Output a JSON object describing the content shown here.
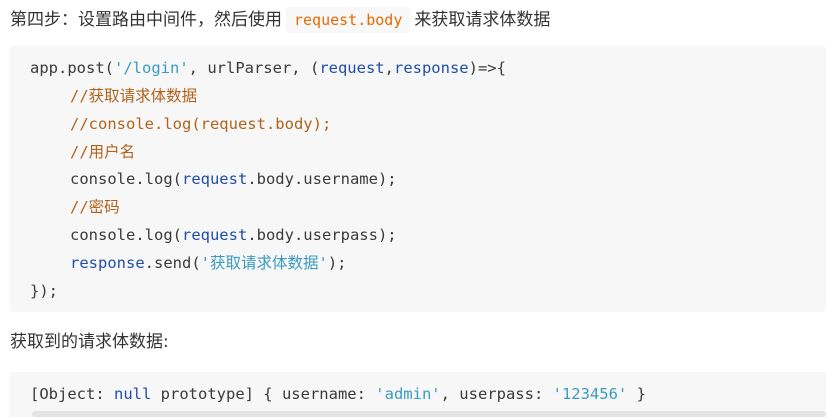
{
  "step": {
    "prefix": "第四步：设置路由中间件，然后使用",
    "inline_code": "request.body",
    "suffix": "来获取请求体数据"
  },
  "code": {
    "l1": {
      "p1": "app.post(",
      "s1": "'/login'",
      "p2": ", urlParser, (",
      "v1": "request",
      "p3": ",",
      "v2": "response",
      "p4": ")=>{"
    },
    "l2": {
      "c": "//获取请求体数据"
    },
    "l3": {
      "c": "//console.log(request.body);"
    },
    "l4": {
      "c": "//用户名"
    },
    "l5": {
      "p1": "console.log(",
      "v1": "request",
      "p2": ".body.username);"
    },
    "l6": {
      "c": "//密码"
    },
    "l7": {
      "p1": "console.log(",
      "v1": "request",
      "p2": ".body.userpass);"
    },
    "l8": {
      "v1": "response",
      "p1": ".send(",
      "s1": "'获取请求体数据'",
      "p2": ");"
    },
    "l9": {
      "p1": "});"
    }
  },
  "result": {
    "label": "获取到的请求体数据:",
    "p1": "[Object: ",
    "v1": "null",
    "p2": " prototype] { username: ",
    "s1": "'admin'",
    "p3": ", userpass: ",
    "s2": "'123456'",
    "p4": " }"
  }
}
